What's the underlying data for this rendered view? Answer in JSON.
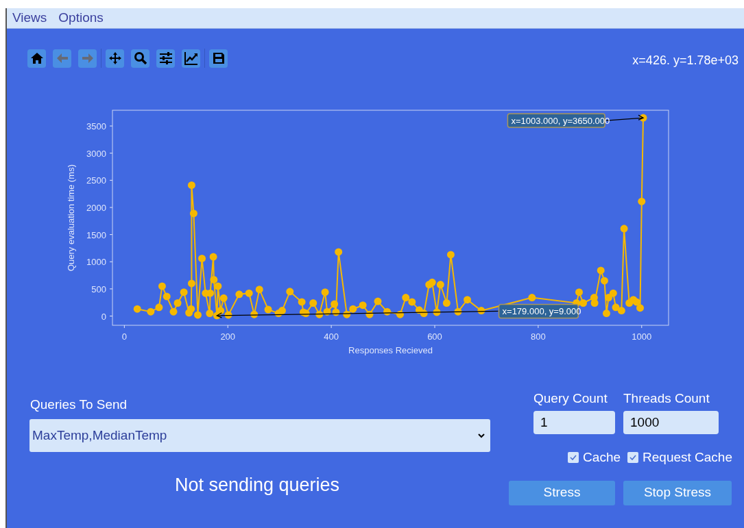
{
  "menu": [
    "Views",
    "Options"
  ],
  "toolbar": [
    [
      {
        "kind": "home",
        "disabled": false
      },
      {
        "kind": "back",
        "disabled": true
      },
      {
        "kind": "forward",
        "disabled": true
      }
    ],
    [
      {
        "kind": "pan",
        "disabled": false
      },
      {
        "kind": "zoom",
        "disabled": false
      },
      {
        "kind": "configure",
        "disabled": false
      },
      {
        "kind": "edit-curve",
        "disabled": false
      }
    ],
    [
      {
        "kind": "save",
        "disabled": false
      }
    ]
  ],
  "cursor_readout": "x=426. y=1.78e+03",
  "chart": {
    "chart_data": {
      "type": "line",
      "xlabel": "Responses Recieved",
      "ylabel": "Query evaluation time (ms)",
      "x": [
        25,
        51,
        67,
        73,
        82,
        95,
        103,
        115,
        125,
        129,
        130,
        130,
        134,
        142,
        150,
        157,
        165,
        166,
        172,
        173,
        179,
        181,
        186,
        192,
        201,
        222,
        241,
        251,
        261,
        278,
        298,
        305,
        320,
        343,
        346,
        351,
        365,
        377,
        388,
        392,
        406,
        409,
        414,
        430,
        442,
        461,
        474,
        490,
        508,
        533,
        544,
        556,
        570,
        579,
        589,
        595,
        604,
        611,
        623,
        631,
        645,
        663,
        690,
        788,
        874,
        879,
        887,
        908,
        909,
        921,
        928,
        932,
        936,
        945,
        950,
        961,
        966,
        976,
        984,
        990,
        997,
        1000,
        1003
      ],
      "series": [
        {
          "color": "#f5b800",
          "marker": "o",
          "values": [
            130,
            80,
            160,
            550,
            360,
            80,
            240,
            440,
            60,
            130,
            600,
            2410,
            1890,
            20,
            1060,
            420,
            50,
            420,
            1090,
            670,
            9,
            550,
            100,
            330,
            20,
            400,
            420,
            30,
            490,
            120,
            50,
            100,
            450,
            260,
            70,
            50,
            240,
            30,
            440,
            80,
            220,
            70,
            1180,
            30,
            130,
            200,
            30,
            270,
            80,
            30,
            340,
            260,
            110,
            50,
            580,
            620,
            70,
            580,
            240,
            1130,
            80,
            300,
            100,
            340,
            240,
            440,
            240,
            340,
            240,
            840,
            650,
            50,
            340,
            420,
            160,
            100,
            1610,
            240,
            300,
            260,
            150,
            2110,
            3650
          ]
        }
      ],
      "xlim": [
        -23,
        1052
      ],
      "ylim": [
        -170,
        3790
      ],
      "xticks": [
        0,
        200,
        400,
        600,
        800,
        1000
      ],
      "yticks": [
        0,
        500,
        1000,
        1500,
        2000,
        2500,
        3000,
        3500
      ],
      "annotations": [
        {
          "text": "x=1003.000, y=3650.000",
          "x": 1003,
          "y": 3650
        },
        {
          "text": "x=179.000, y=9.000",
          "x": 179,
          "y": 9
        }
      ]
    }
  },
  "queries": {
    "label": "Queries To Send",
    "value": "MaxTemp,MedianTemp"
  },
  "status": "Not sending queries",
  "fields": [
    {
      "label": "Query Count",
      "value": "1"
    },
    {
      "label": "Threads Count",
      "value": "1000"
    }
  ],
  "checkboxes": [
    {
      "label": "Cache",
      "checked": true
    },
    {
      "label": "Request Cache",
      "checked": true
    }
  ],
  "buttons": [
    "Stress",
    "Stop Stress"
  ]
}
